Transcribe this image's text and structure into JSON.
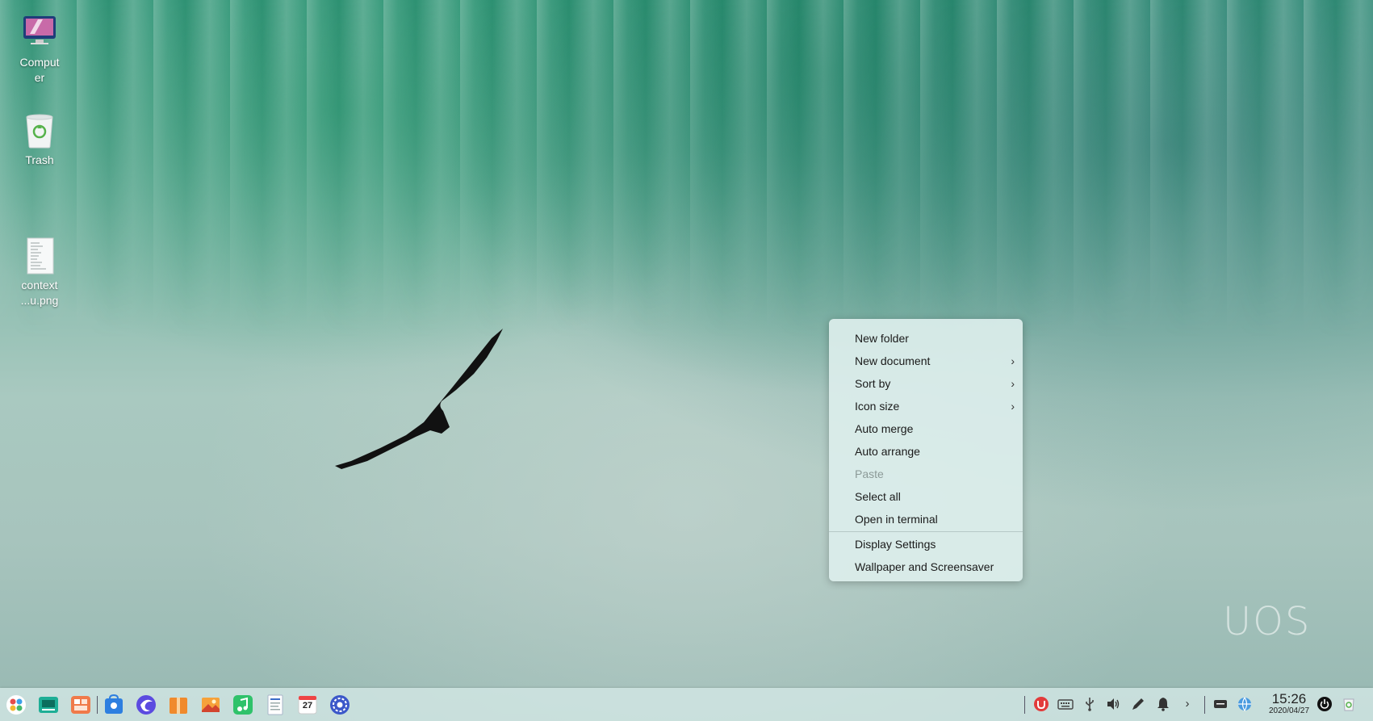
{
  "desktop": {
    "icons": [
      {
        "label": "Computer",
        "icon": "computer-icon"
      },
      {
        "label": "Trash",
        "icon": "trash-icon"
      },
      {
        "label": "context\n...u.png",
        "icon": "image-file-icon"
      }
    ],
    "watermark": "UOS"
  },
  "context_menu": {
    "items": [
      {
        "label": "New folder",
        "submenu": false,
        "enabled": true
      },
      {
        "label": "New document",
        "submenu": true,
        "enabled": true
      },
      {
        "label": "Sort by",
        "submenu": true,
        "enabled": true
      },
      {
        "label": "Icon size",
        "submenu": true,
        "enabled": true
      },
      {
        "label": "Auto merge",
        "submenu": false,
        "enabled": true
      },
      {
        "label": "Auto arrange",
        "submenu": false,
        "enabled": true
      },
      {
        "label": "Paste",
        "submenu": false,
        "enabled": false
      },
      {
        "label": "Select all",
        "submenu": false,
        "enabled": true
      },
      {
        "label": "Open in terminal",
        "submenu": false,
        "enabled": true
      },
      {
        "label": "Display Settings",
        "submenu": false,
        "enabled": true
      },
      {
        "label": "Wallpaper and Screensaver",
        "submenu": false,
        "enabled": true
      }
    ],
    "submenu_arrow": "›"
  },
  "dock": {
    "apps": [
      "launcher-icon",
      "multitasking-icon",
      "workspace-icon",
      "app-store-icon",
      "browser-icon",
      "archive-manager-icon",
      "image-viewer-icon",
      "music-icon",
      "document-viewer-icon",
      "calendar-icon",
      "settings-icon"
    ],
    "calendar_day": "27",
    "tray": [
      "security-icon",
      "keyboard-icon",
      "usb-icon",
      "volume-icon",
      "draw-pen-icon",
      "notification-icon",
      "expand-icon",
      "keyboard-layout-icon",
      "network-icon"
    ],
    "expand_glyph": "›",
    "clock": {
      "time": "15:26",
      "date": "2020/04/27"
    }
  }
}
